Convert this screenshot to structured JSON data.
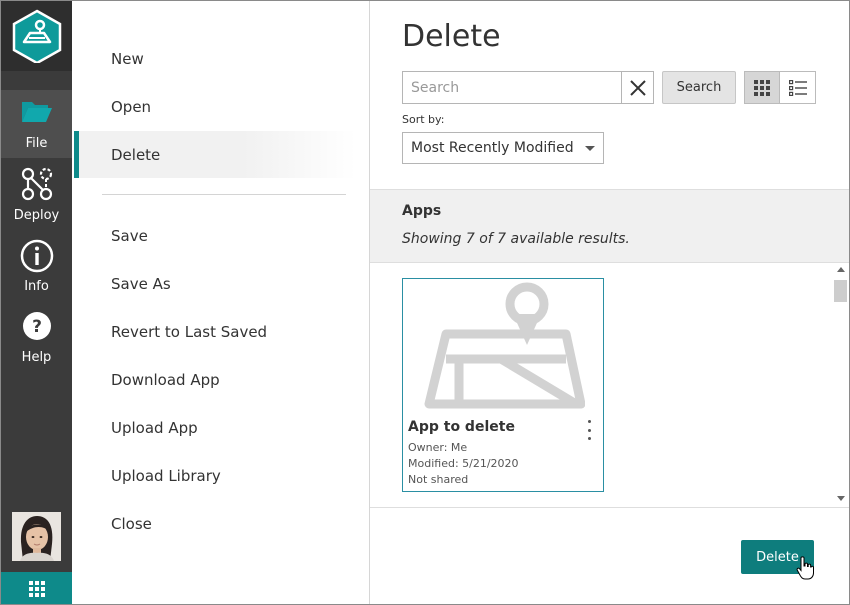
{
  "rail": {
    "items": [
      {
        "label": "File",
        "icon": "folder-icon"
      },
      {
        "label": "Deploy",
        "icon": "deploy-icon"
      },
      {
        "label": "Info",
        "icon": "info-icon"
      },
      {
        "label": "Help",
        "icon": "help-icon"
      }
    ],
    "apps_icon": "app-grid-icon"
  },
  "menu": {
    "items_top": [
      "New",
      "Open",
      "Delete"
    ],
    "items_bottom": [
      "Save",
      "Save As",
      "Revert to Last Saved",
      "Download App",
      "Upload App",
      "Upload Library",
      "Close"
    ],
    "selected": "Delete"
  },
  "panel": {
    "title": "Delete",
    "search": {
      "placeholder": "Search",
      "value": "",
      "button_label": "Search"
    },
    "sort": {
      "label": "Sort by:",
      "value": "Most Recently Modified"
    },
    "results": {
      "heading": "Apps",
      "count_text": "Showing 7 of 7 available results."
    },
    "card": {
      "name": "App to delete",
      "owner": "Owner: Me",
      "modified": "Modified: 5/21/2020",
      "sharing": "Not shared"
    },
    "delete_button": "Delete"
  },
  "colors": {
    "accent": "#0e8a8a",
    "rail": "#3b3b3b",
    "button": "#0e7d7d"
  }
}
